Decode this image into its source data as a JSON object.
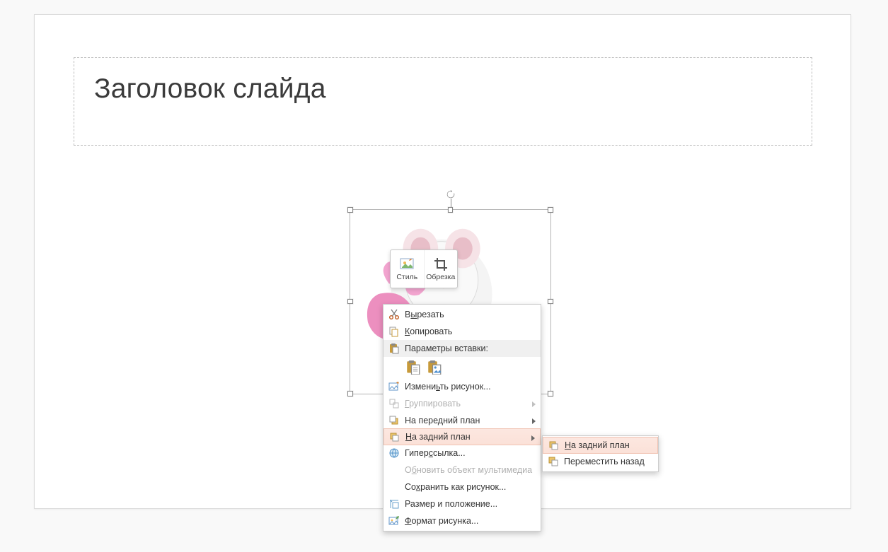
{
  "slide": {
    "title": "Заголовок слайда"
  },
  "mini_toolbar": {
    "style": "Стиль",
    "crop": "Обрезка"
  },
  "context_menu": {
    "cut": "Вырезать",
    "cut_u": "ы",
    "copy": "Копировать",
    "copy_u": "К",
    "paste_options": "Параметры вставки:",
    "change_picture": "Изменить рисунок...",
    "change_picture_u": "ь",
    "group": "Группировать",
    "group_u": "Г",
    "bring_front": "На передний план",
    "send_back_pre": "Н",
    "send_back_rest": "а задний план",
    "hyperlink": "Гиперссылка...",
    "hyperlink_u": "с",
    "update_media": "Обновить объект мультимедиа",
    "update_media_u": "б",
    "save_as_picture": "Сохранить как рисунок...",
    "save_as_picture_u": "х",
    "size_position": "Размер и положение...",
    "format_picture": "Формат рисунка...",
    "format_picture_u": "Ф"
  },
  "submenu": {
    "send_to_back_pre": "Н",
    "send_to_back_rest": "а задний план",
    "send_backward": "Переместить назад"
  }
}
